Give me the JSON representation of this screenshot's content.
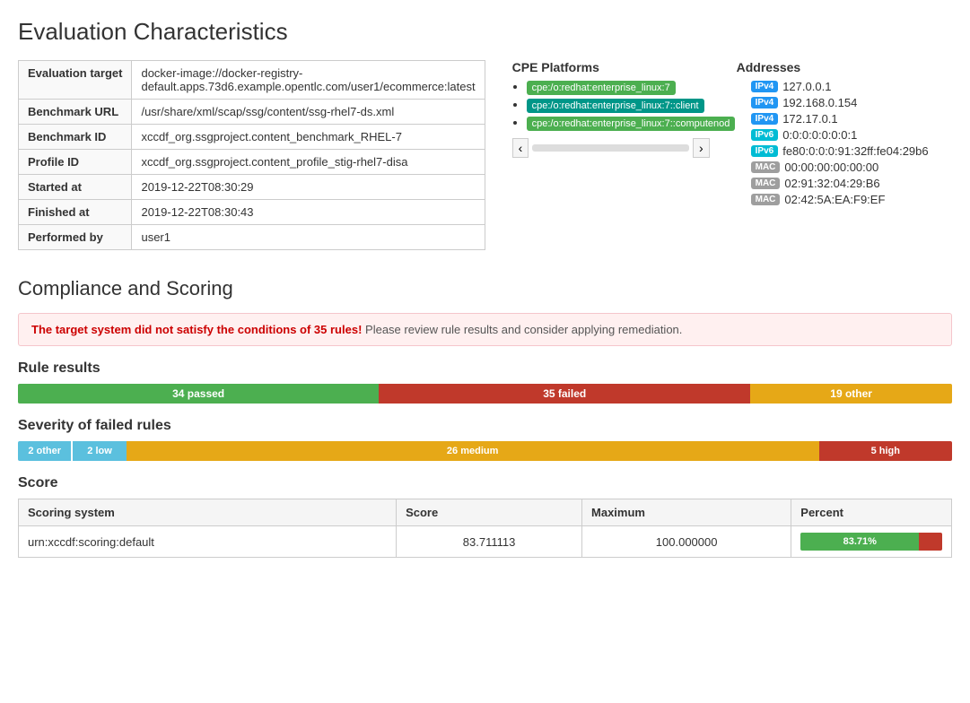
{
  "page": {
    "title": "Evaluation Characteristics",
    "compliance_title": "Compliance and Scoring"
  },
  "eval_table": {
    "rows": [
      {
        "label": "Evaluation target",
        "value": "docker-image://docker-registry-default.apps.73d6.example.opentlc.com/user1/ecommerce:latest"
      },
      {
        "label": "Benchmark URL",
        "value": "/usr/share/xml/scap/ssg/content/ssg-rhel7-ds.xml"
      },
      {
        "label": "Benchmark ID",
        "value": "xccdf_org.ssgproject.content_benchmark_RHEL-7"
      },
      {
        "label": "Profile ID",
        "value": "xccdf_org.ssgproject.content_profile_stig-rhel7-disa"
      },
      {
        "label": "Started at",
        "value": "2019-12-22T08:30:29"
      },
      {
        "label": "Finished at",
        "value": "2019-12-22T08:30:43"
      },
      {
        "label": "Performed by",
        "value": "user1"
      }
    ]
  },
  "cpe": {
    "title": "CPE Platforms",
    "items": [
      {
        "text": "cpe:/o:redhat:enterprise_linux:7",
        "color": "green"
      },
      {
        "text": "cpe:/o:redhat:enterprise_linux:7::client",
        "color": "teal"
      },
      {
        "text": "cpe:/o:redhat:enterprise_linux:7::computenod",
        "color": "green"
      }
    ]
  },
  "addresses": {
    "title": "Addresses",
    "items": [
      {
        "type": "IPv4",
        "badge_class": "ipv4",
        "value": "127.0.0.1"
      },
      {
        "type": "IPv4",
        "badge_class": "ipv4",
        "value": "192.168.0.154"
      },
      {
        "type": "IPv4",
        "badge_class": "ipv4",
        "value": "172.17.0.1"
      },
      {
        "type": "IPv6",
        "badge_class": "ipv6",
        "value": "0:0:0:0:0:0:0:1"
      },
      {
        "type": "IPv6",
        "badge_class": "ipv6",
        "value": "fe80:0:0:0:91:32ff:fe04:29b6"
      },
      {
        "type": "MAC",
        "badge_class": "mac",
        "value": "00:00:00:00:00:00"
      },
      {
        "type": "MAC",
        "badge_class": "mac",
        "value": "02:91:32:04:29:B6"
      },
      {
        "type": "MAC",
        "badge_class": "mac",
        "value": "02:42:5A:EA:F9:EF"
      }
    ]
  },
  "compliance": {
    "alert": {
      "bold": "The target system did not satisfy the conditions of 35 rules!",
      "rest": " Please review rule results and consider applying remediation."
    },
    "rule_results_title": "Rule results",
    "rule_results": {
      "passed": "34 passed",
      "failed": "35 failed",
      "other": "19 other"
    },
    "severity_title": "Severity of failed rules",
    "severity": {
      "other": "2 other",
      "low": "2 low",
      "medium": "26 medium",
      "high": "5 high"
    },
    "score_title": "Score",
    "score_table": {
      "headers": [
        "Scoring system",
        "Score",
        "Maximum",
        "Percent"
      ],
      "row": {
        "system": "urn:xccdf:scoring:default",
        "score": "83.711113",
        "maximum": "100.000000",
        "percent": "83.71%",
        "percent_value": 83.71
      }
    }
  }
}
